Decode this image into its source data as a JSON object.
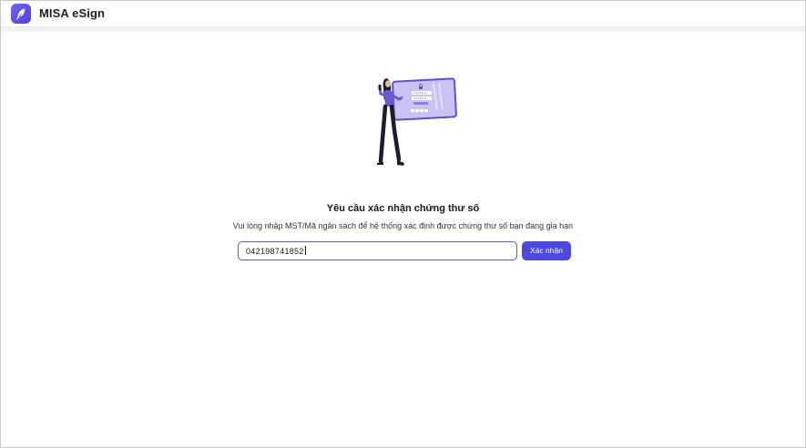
{
  "header": {
    "app_name": "MISA eSign",
    "logo_icon": "quill-feather-icon"
  },
  "main": {
    "illustration_icon": "woman-login-screen-illustration",
    "title": "Yêu cầu xác nhận chứng thư số",
    "subtitle": "Vui lòng nhập MST/Mã ngân sách để hệ thống xác định được chứng thư số bạn đang gia hạn",
    "tax_code_input": {
      "value": "042198741852",
      "placeholder": ""
    },
    "confirm_button_label": "Xác nhận"
  },
  "colors": {
    "accent": "#4d48e0",
    "logo_gradient_start": "#6f66f2",
    "logo_gradient_end": "#4b3fe0",
    "illustration_purple": "#6a5bd6",
    "illustration_screen": "#c8c3f3"
  }
}
